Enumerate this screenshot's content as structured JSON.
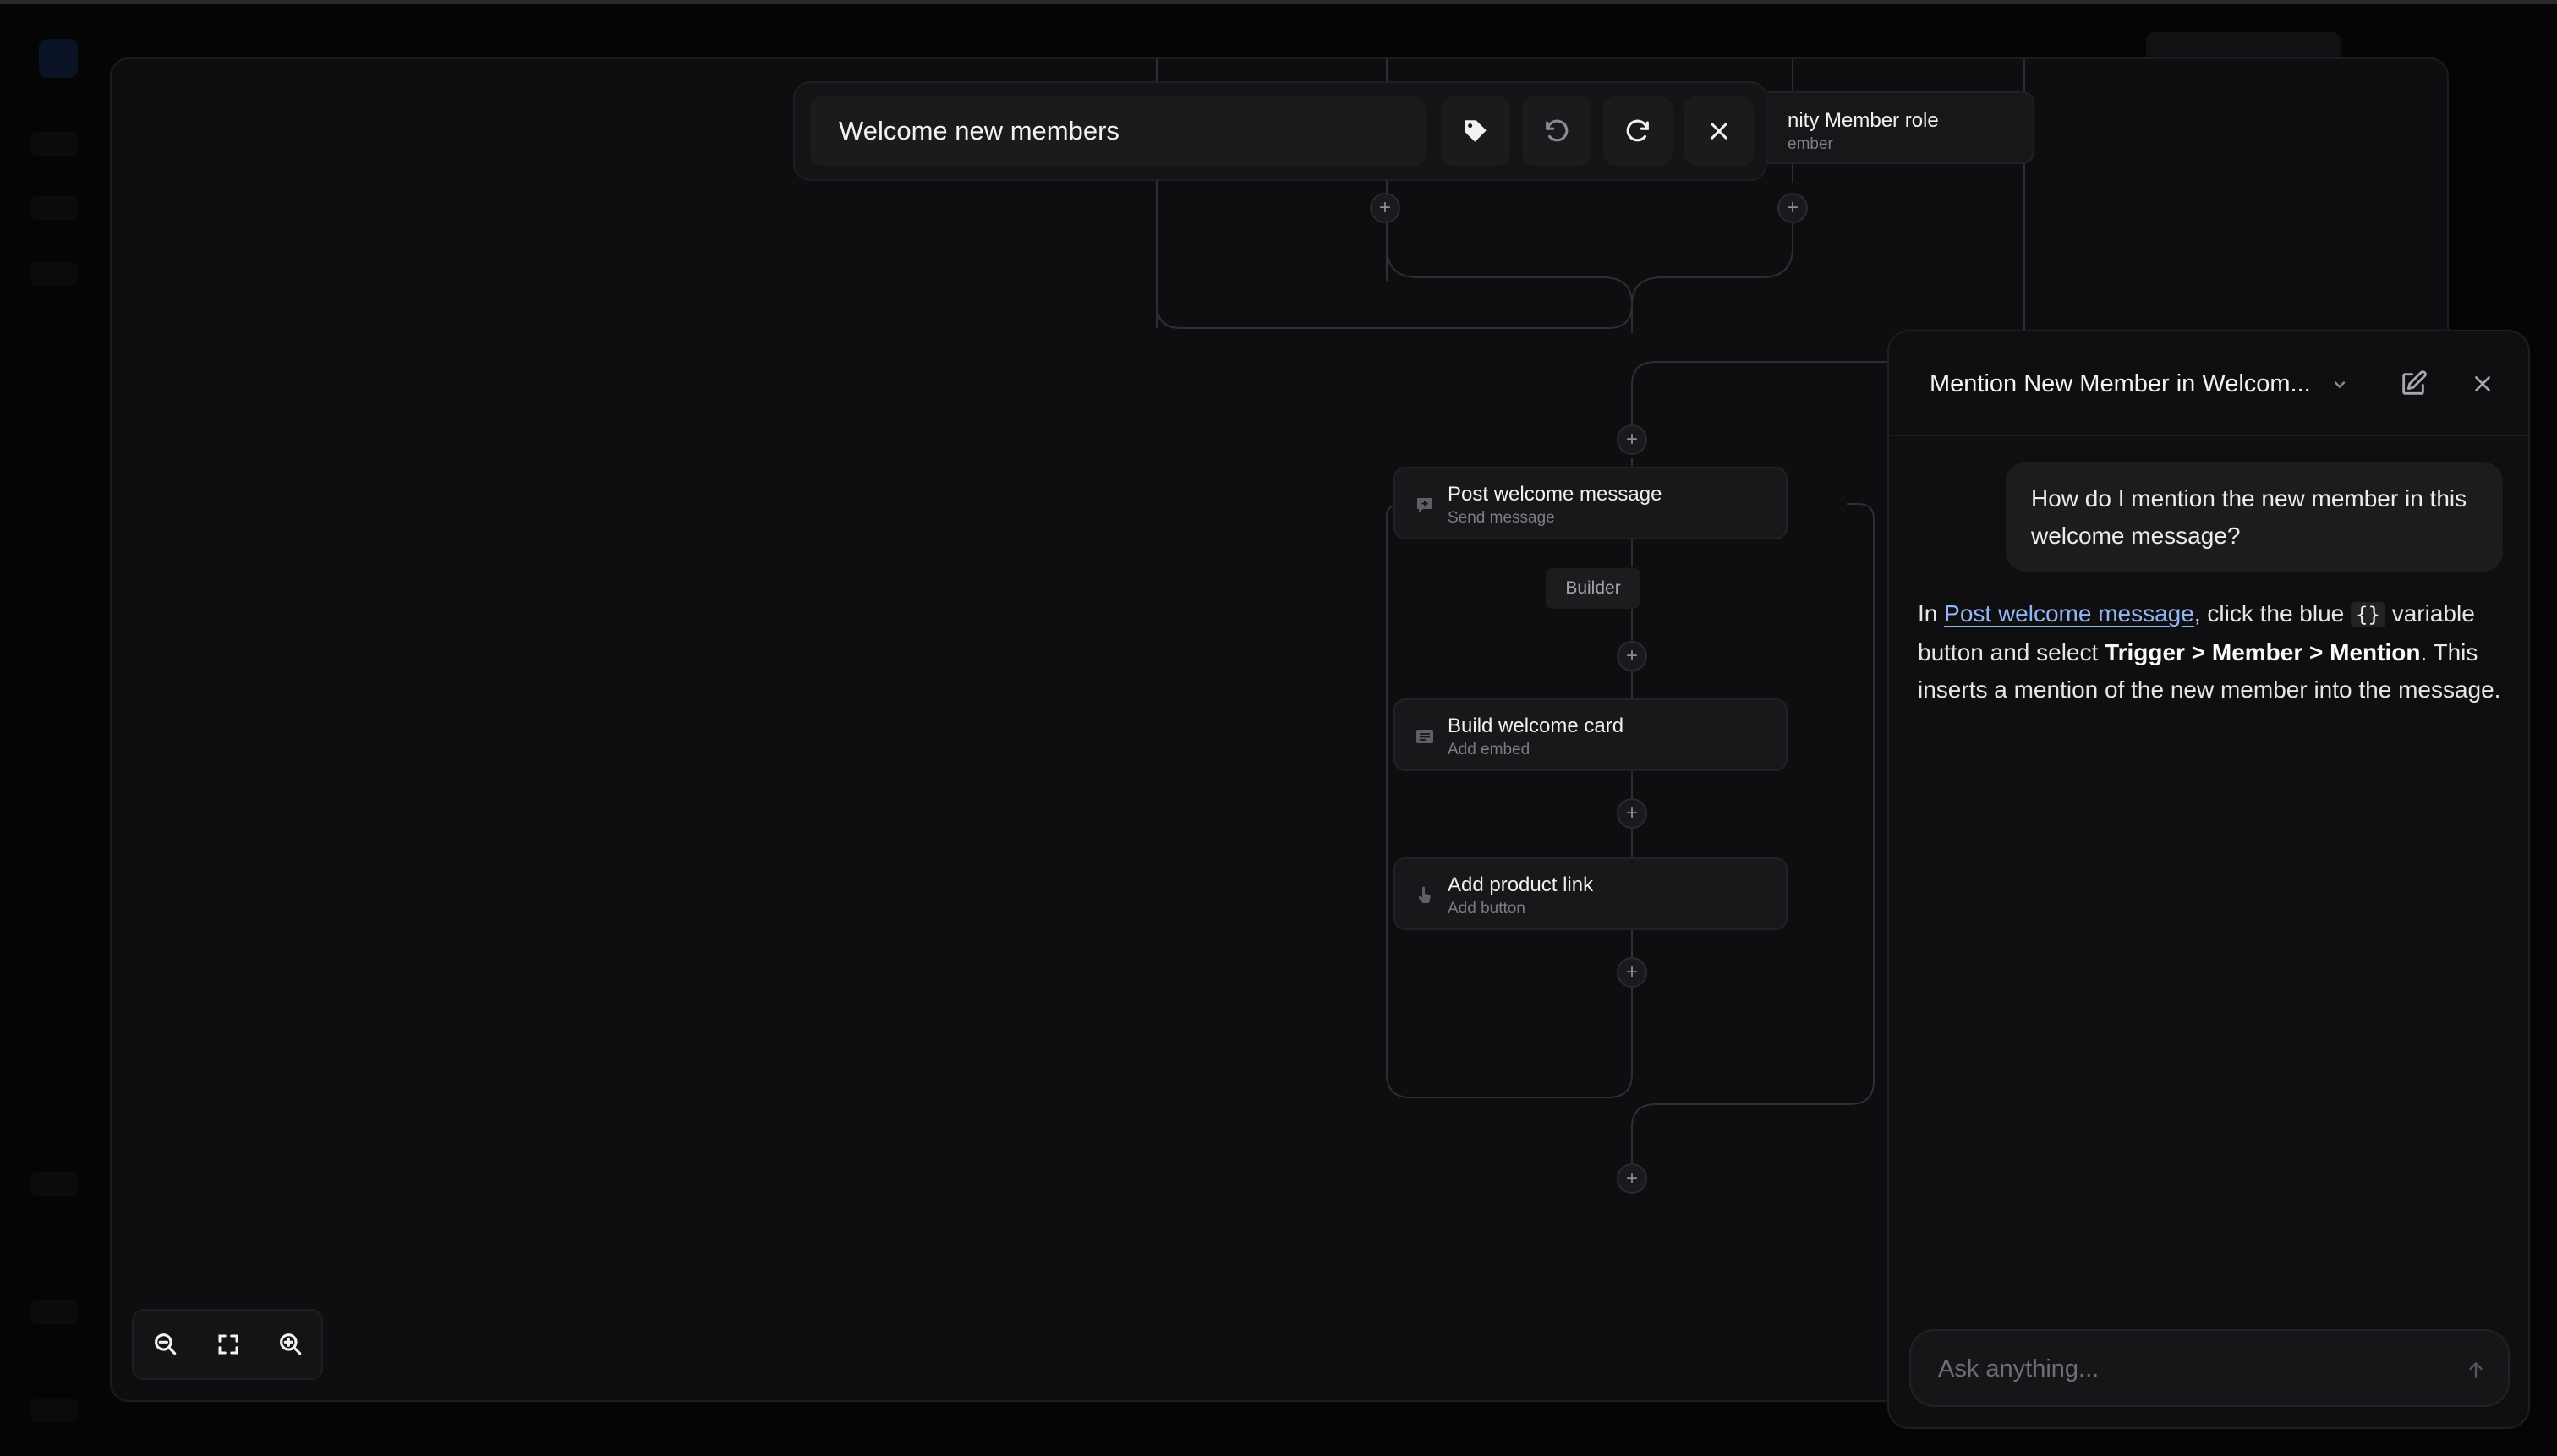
{
  "toolbar": {
    "title": "Welcome new members",
    "tag_icon": "tag-icon",
    "undo_icon": "undo-icon",
    "redo_icon": "redo-icon",
    "close_icon": "close-icon"
  },
  "flow": {
    "partial_node": {
      "title": "nity Member role",
      "subtitle": "ember"
    },
    "nodes": [
      {
        "title": "Post welcome message",
        "subtitle": "Send message",
        "icon": "message-icon"
      },
      {
        "title": "Build welcome card",
        "subtitle": "Add embed",
        "icon": "embed-icon"
      },
      {
        "title": "Add product link",
        "subtitle": "Add button",
        "icon": "pointer-hand-icon"
      }
    ],
    "branch_label": "Builder",
    "plus_symbol": "+"
  },
  "zoom": {
    "zoom_out_icon": "zoom-out-icon",
    "fit_icon": "fit-screen-icon",
    "zoom_in_icon": "zoom-in-icon"
  },
  "chat": {
    "title": "Mention New Member in Welcom...",
    "user_message": "How do I mention the new member in this welcome message?",
    "answer": {
      "p1": "In ",
      "link": "Post welcome message",
      "p2": ", click the blue ",
      "code": "{}",
      "p3": " variable button and select ",
      "bold1": "Trigger > Member > Mention",
      "p4": ". This inserts a mention of the new member into the message."
    },
    "input_placeholder": "Ask anything..."
  },
  "colors": {
    "background": "#000000",
    "canvas": "#0e0e10",
    "node": "#18181b",
    "link": "#93b4f5",
    "connector": "#2e2e33"
  }
}
